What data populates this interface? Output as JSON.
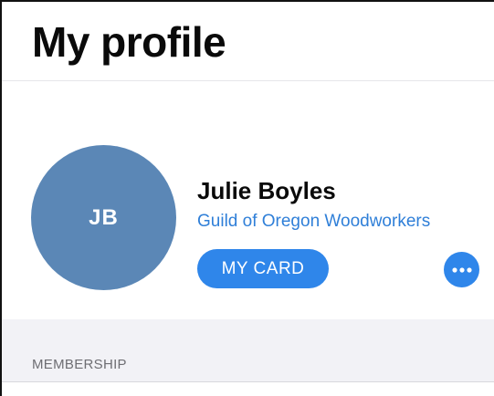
{
  "header": {
    "title": "My profile"
  },
  "profile": {
    "initials": "JB",
    "name": "Julie Boyles",
    "organization": "Guild of Oregon Woodworkers",
    "card_button_label": "MY CARD",
    "more_button_icon": "more-horizontal-icon",
    "avatar_color": "#5b87b6",
    "accent_color": "#2f86ea",
    "link_color": "#2f7fd8"
  },
  "sections": {
    "membership_label": "MEMBERSHIP",
    "background_color": "#f2f2f6"
  }
}
